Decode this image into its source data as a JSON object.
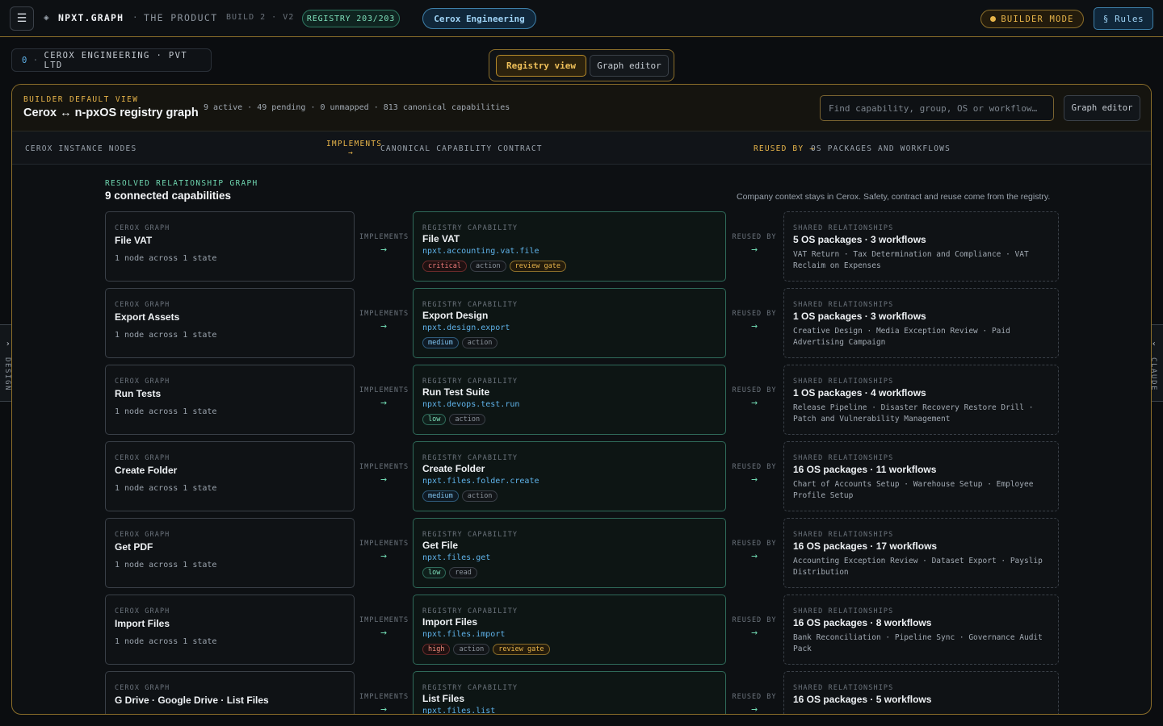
{
  "topbar": {
    "menu_icon": "☰",
    "brand_mark": "◈",
    "brand": "NPXT.GRAPH",
    "sep": "·",
    "crumb": "THE PRODUCT",
    "build": "BUILD 2 · V2",
    "registry_pill": "REGISTRY 203/203",
    "tenant": "Cerox Engineering",
    "builder_mode": "BUILDER MODE",
    "rules": "§ Rules"
  },
  "company": {
    "count": "0",
    "sep": "·",
    "name": "CEROX ENGINEERING · PVT LTD"
  },
  "view_toggle": {
    "registry": "Registry view",
    "graph": "Graph editor"
  },
  "side_tabs": {
    "left": "DESIGN",
    "left_chevron": "›",
    "right": "CLAUDE",
    "right_chevron": "‹"
  },
  "panel": {
    "eyebrow": "BUILDER DEFAULT VIEW",
    "title": "Cerox ↔ n-pxOS registry graph",
    "stats": "9 active · 49 pending · 0 unmapped · 813 canonical capabilities",
    "search_placeholder": "Find capability, group, OS or workflow…",
    "graph_editor": "Graph editor"
  },
  "columns": {
    "left": "CEROX INSTANCE NODES",
    "implements": "IMPLEMENTS",
    "implements_arrow": "→",
    "middle": "CANONICAL CAPABILITY CONTRACT",
    "reused_by": "REUSED BY →",
    "right": "OS PACKAGES AND WORKFLOWS"
  },
  "graph": {
    "eyebrow": "RESOLVED RELATIONSHIP GRAPH",
    "title": "9 connected capabilities",
    "note": "Company context stays in Cerox. Safety, contract and reuse come from the registry."
  },
  "labels": {
    "left_eyebrow": "CEROX GRAPH",
    "mid_eyebrow": "REGISTRY CAPABILITY",
    "right_eyebrow": "SHARED RELATIONSHIPS",
    "implements": "IMPLEMENTS",
    "reused_by": "REUSED BY",
    "arrow": "→"
  },
  "rows": [
    {
      "node": "File VAT",
      "node_sub": "1 node across 1 state",
      "cap": "File VAT",
      "cap_id": "npxt.accounting.vat.file",
      "tags": [
        "critical",
        "action",
        "review gate"
      ],
      "rel_title": "5 OS packages · 3 workflows",
      "rel_body": "VAT Return · Tax Determination and Compliance · VAT Reclaim on Expenses"
    },
    {
      "node": "Export Assets",
      "node_sub": "1 node across 1 state",
      "cap": "Export Design",
      "cap_id": "npxt.design.export",
      "tags": [
        "medium",
        "action"
      ],
      "rel_title": "1 OS packages · 3 workflows",
      "rel_body": "Creative Design · Media Exception Review · Paid Advertising Campaign"
    },
    {
      "node": "Run Tests",
      "node_sub": "1 node across 1 state",
      "cap": "Run Test Suite",
      "cap_id": "npxt.devops.test.run",
      "tags": [
        "low",
        "action"
      ],
      "rel_title": "1 OS packages · 4 workflows",
      "rel_body": "Release Pipeline · Disaster Recovery Restore Drill · Patch and Vulnerability Management"
    },
    {
      "node": "Create Folder",
      "node_sub": "1 node across 1 state",
      "cap": "Create Folder",
      "cap_id": "npxt.files.folder.create",
      "tags": [
        "medium",
        "action"
      ],
      "rel_title": "16 OS packages · 11 workflows",
      "rel_body": "Chart of Accounts Setup · Warehouse Setup · Employee Profile Setup"
    },
    {
      "node": "Get PDF",
      "node_sub": "1 node across 1 state",
      "cap": "Get File",
      "cap_id": "npxt.files.get",
      "tags": [
        "low",
        "read"
      ],
      "rel_title": "16 OS packages · 17 workflows",
      "rel_body": "Accounting Exception Review · Dataset Export · Payslip Distribution"
    },
    {
      "node": "Import Files",
      "node_sub": "1 node across 1 state",
      "cap": "Import Files",
      "cap_id": "npxt.files.import",
      "tags": [
        "high",
        "action",
        "review gate"
      ],
      "rel_title": "16 OS packages · 8 workflows",
      "rel_body": "Bank Reconciliation · Pipeline Sync · Governance Audit Pack"
    },
    {
      "node": "G Drive · Google Drive · List Files",
      "node_sub": "",
      "cap": "List Files",
      "cap_id": "npxt.files.list",
      "tags": [],
      "rel_title": "16 OS packages · 5 workflows",
      "rel_body": ""
    }
  ]
}
